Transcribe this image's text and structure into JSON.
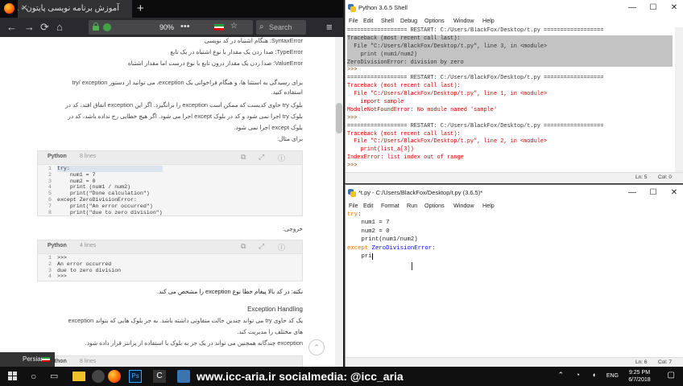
{
  "browser": {
    "tab_title": "آموزش برنامه نویسی پایتون - ...",
    "zoom": "90%",
    "url_dots": "•••",
    "search_placeholder": "Search",
    "page": {
      "error_lines": [
        "SyntaxError: هنگام اشتباه در کد نویسی",
        "TypeError: صدا زدن یک مقدار با نوع اشتباه در یک تابع",
        "ValueError: صدا زدن یک مقدار درون تابع با نوع درست اما مقدار اشتباه"
      ],
      "para1": [
        "برای رسیدگی به استثنا ها، و هنگام فراخوانی یک exception، می توانید از دستور try/ exception",
        "استفاده کنید."
      ],
      "para2": [
        "بلوک try حاوی کدیست که ممکن است exception را برانگیزد. اگر این exception اتفاق افتد، کد در",
        "بلوک try اجرا نمی شود و کد در بلوک except اجرا می شود. اگر هیچ خطایی رخ نداده باشد، کد در",
        "بلوک except اجرا نمی شود."
      ],
      "example_label": "برای مثال:",
      "code1": {
        "lang": "Python",
        "lines_label": "8 lines",
        "gutter": [
          "1",
          "2",
          "3",
          "4",
          "5",
          "6",
          "7",
          "8"
        ],
        "lines": [
          "try:",
          "    num1 = 7",
          "    num2 = 0",
          "    print (num1 / num2)",
          "    print(\"Done calculation\")",
          "except ZeroDivisionError:",
          "    print(\"An error occurred\")",
          "    print(\"due to zero division\")"
        ]
      },
      "output_label": "خروجی:",
      "code2": {
        "lang": "Python",
        "lines_label": "4 lines",
        "gutter": [
          "1",
          "2",
          "3",
          "4"
        ],
        "lines": [
          ">>>",
          "An error occurred",
          "due to zero division",
          ">>>"
        ]
      },
      "note": "نکته: در کد بالا پیغام خطا نوع exception را مشخص می کند.",
      "heading": "Exception Handling",
      "para3": [
        "یک کد حاوی try می تواند چندین حالت متفاوتی داشته باشد. به جز بلوک هایی که بتواند exception",
        "های مختلف را مدیریت کند."
      ],
      "para4": "exception چندگانه همچنین می تواند در یک جز به بلوک با استفاده از پرانتز قرار داده شود.",
      "code3_lang": "Python",
      "code3_lines": "8 lines"
    },
    "lang_button": "Persian"
  },
  "shell": {
    "title": "Python 3.6.5 Shell",
    "menu": [
      "File",
      "Edit",
      "Shell",
      "Debug",
      "Options",
      "Window",
      "Help"
    ],
    "lines": [
      {
        "t": "================== RESTART: C:/Users/BlackFox/Desktop/t.py ==================",
        "c": "normal"
      },
      {
        "t": "Traceback (most recent call last):",
        "c": "sel"
      },
      {
        "t": "  File \"C:/Users/BlackFox/Desktop/t.py\", line 3, in <module>",
        "c": "sel"
      },
      {
        "t": "    print (num1/num2)",
        "c": "sel"
      },
      {
        "t": "ZeroDivisionError: division by zero",
        "c": "sel"
      },
      {
        "t": ">>>",
        "c": "prompt"
      },
      {
        "t": "================== RESTART: C:/Users/BlackFox/Desktop/t.py ==================",
        "c": "normal"
      },
      {
        "t": "Traceback (most recent call last):",
        "c": "err"
      },
      {
        "t": "  File \"C:/Users/BlackFox/Desktop/t.py\", line 1, in <module>",
        "c": "err"
      },
      {
        "t": "    import sample",
        "c": "err"
      },
      {
        "t": "ModuleNotFoundError: No module named 'sample'",
        "c": "err"
      },
      {
        "t": ">>>",
        "c": "prompt"
      },
      {
        "t": "================== RESTART: C:/Users/BlackFox/Desktop/t.py ==================",
        "c": "normal"
      },
      {
        "t": "Traceback (most recent call last):",
        "c": "err"
      },
      {
        "t": "  File \"C:/Users/BlackFox/Desktop/t.py\", line 2, in <module>",
        "c": "err"
      },
      {
        "t": "    print(list_a[3])",
        "c": "err"
      },
      {
        "t": "IndexError: list index out of range",
        "c": "err"
      },
      {
        "t": ">>>",
        "c": "prompt"
      }
    ],
    "status_ln": "Ln: 5",
    "status_col": "Col: 0"
  },
  "editor": {
    "title": "*t.py - C:/Users/BlackFox/Desktop/t.py (3.6.5)*",
    "menu": [
      "File",
      "Edit",
      "Format",
      "Run",
      "Options",
      "Window",
      "Help"
    ],
    "lines": [
      [
        {
          "t": "try",
          "c": "kw"
        },
        {
          "t": ":",
          "c": ""
        }
      ],
      [
        {
          "t": "    num1 = 7",
          "c": ""
        }
      ],
      [
        {
          "t": "    num2 = 0",
          "c": ""
        }
      ],
      [
        {
          "t": "    print(num1/num2)",
          "c": ""
        }
      ],
      [
        {
          "t": "except",
          "c": "kw"
        },
        {
          "t": " ZeroDivisionError",
          "c": "def"
        },
        {
          "t": ":",
          "c": ""
        }
      ],
      [
        {
          "t": "    pri",
          "c": ""
        }
      ]
    ],
    "status_ln": "Ln: 6",
    "status_col": "Col: 7"
  },
  "taskbar": {
    "banner": "www.icc-aria.ir   socialmedia: @icc_aria",
    "lang": "ENG",
    "time": "9:25 PM",
    "date": "6/7/2018"
  }
}
